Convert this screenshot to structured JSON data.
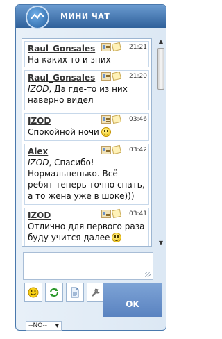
{
  "header": {
    "title": "МИНИ ЧАТ"
  },
  "messages": [
    {
      "author": "Raul_Gonsales",
      "time": "21:21",
      "text": "На каких то и зних"
    },
    {
      "author": "Raul_Gonsales",
      "time": "21:20",
      "mention": "IZOD",
      "text": ", Да где-то из них наверно видел"
    },
    {
      "author": "IZOD",
      "time": "03:46",
      "text": "Спокойной ночи"
    },
    {
      "author": "Alex",
      "time": "03:42",
      "mention": "IZOD",
      "text": ", Спасибо! Нормальненько. Всё ребят теперь точно спать, а то жена уже в шоке)))"
    },
    {
      "author": "IZOD",
      "time": "03:41",
      "text": "Отлично для первого раза буду учится далее"
    }
  ],
  "input": {
    "value": ""
  },
  "toolbar": {
    "icons": [
      "smiley-icon",
      "refresh-icon",
      "document-icon",
      "settings-icon"
    ]
  },
  "ok_button": {
    "label": "OK"
  },
  "select": {
    "value": "--NO--"
  }
}
